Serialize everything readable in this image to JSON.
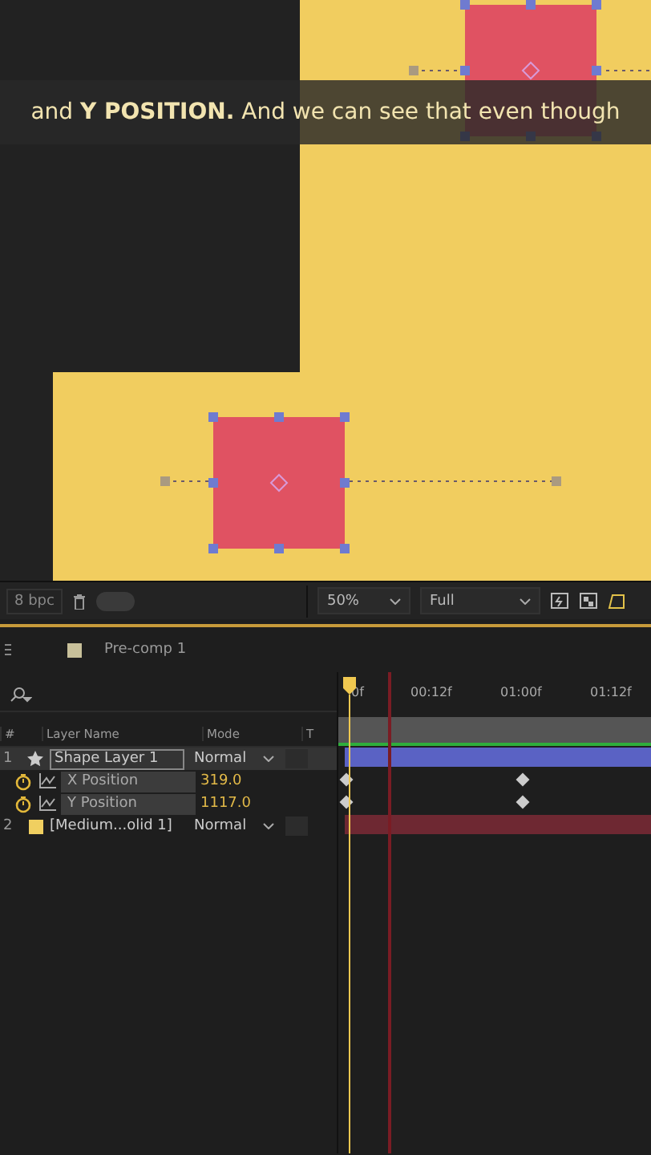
{
  "caption": "and **Y POSITION.** And we can see that even though",
  "viewer_toolbar": {
    "bit_depth": "8 bpc",
    "toggle_on": false,
    "zoom": "50%",
    "resolution": "Full"
  },
  "panel_tab": {
    "label": "Pre-comp 1",
    "color": "#c8c09a"
  },
  "columns": [
    "#",
    "Layer Name",
    "Mode",
    "T"
  ],
  "layers": [
    {
      "number": "1",
      "kind": "shape",
      "name": "Shape Layer 1",
      "mode": "Normal",
      "selected": true,
      "properties": [
        {
          "name": "X Position",
          "value": "319.0",
          "keyframed": true
        },
        {
          "name": "Y Position",
          "value": "1117.0",
          "keyframed": true
        }
      ]
    },
    {
      "number": "2",
      "kind": "solid",
      "name": "[Medium...olid 1]",
      "mode": "Normal",
      "selected": false,
      "color": "#f0cf60"
    }
  ],
  "ruler": [
    "0f",
    "00:12f",
    "01:00f",
    "01:12f"
  ]
}
